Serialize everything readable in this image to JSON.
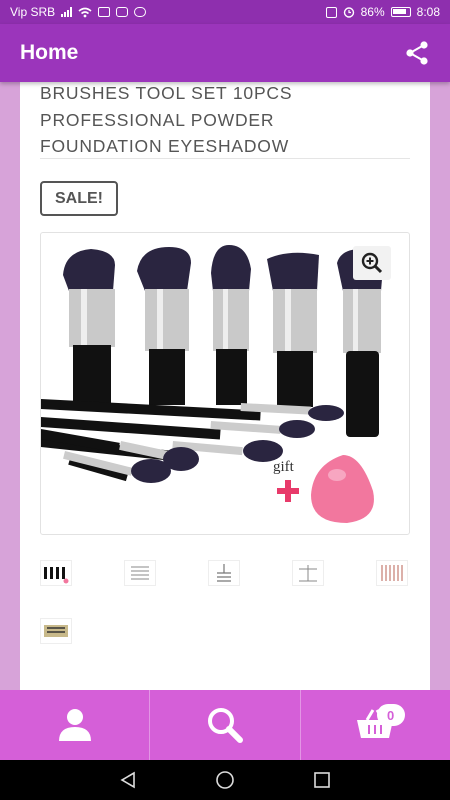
{
  "status_bar": {
    "carrier": "Vip SRB",
    "battery_percent": "86%",
    "time": "8:08"
  },
  "app_bar": {
    "title": "Home",
    "share_icon": "share-icon"
  },
  "product": {
    "title_lines": [
      "BRUSHES TOOL SET 10PCS",
      "PROFESSIONAL POWDER",
      "FOUNDATION EYESHADOW"
    ],
    "sale_label": "SALE!",
    "image_text": "gift",
    "thumbnail_count": 6
  },
  "bottom_nav": {
    "items": [
      {
        "icon": "user-icon"
      },
      {
        "icon": "search-icon"
      },
      {
        "icon": "cart-icon",
        "badge": "0"
      }
    ],
    "color": "#d55fd8"
  },
  "colors": {
    "app_bar": "#9b35bb",
    "status_bar": "#8e2fae",
    "background": "#d7a3d9"
  }
}
